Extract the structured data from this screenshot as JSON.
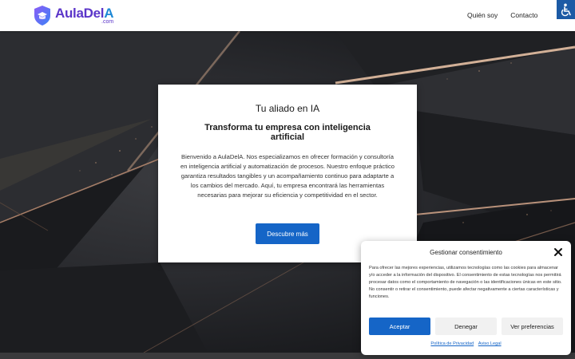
{
  "header": {
    "logo": {
      "main": "AulaDel",
      "accent": "A",
      "sub": ".com"
    },
    "nav": [
      {
        "label": "Quién soy"
      },
      {
        "label": "Contacto"
      }
    ],
    "accessibility_icon": "wheelchair-icon"
  },
  "hero": {
    "card": {
      "title": "Tu aliado en IA",
      "subtitle": "Transforma tu empresa con inteligencia artificial",
      "body": "Bienvenido a AulaDelA. Nos especializamos en ofrecer formación y consultoría en inteligencia artificial y automatización de procesos. Nuestro enfoque práctico garantiza resultados tangibles y un acompañamiento continuo para adaptarte a los cambios del mercado. Aquí, tu empresa encontrará las herramientas necesarias para mejorar su eficiencia y competitividad en el sector.",
      "button": "Descubre más"
    }
  },
  "cookie": {
    "title": "Gestionar consentimiento",
    "text": "Para ofrecer las mejores experiencias, utilizamos tecnologías como las cookies para almacenar y/o acceder a la información del dispositivo. El consentimiento de estas tecnologías nos permitirá procesar datos como el comportamiento de navegación o las identificaciones únicas en este sitio. No consentir o retirar el consentimiento, puede afectar negativamente a ciertas características y funciones.",
    "accept": "Aceptar",
    "deny": "Denegar",
    "preferences": "Ver preferencias",
    "links": {
      "privacy": "Política de Privacidad",
      "legal": "Aviso Legal"
    }
  },
  "colors": {
    "brand_purple": "#5b35c9",
    "brand_blue": "#1e89d6",
    "button_blue": "#1565c7"
  }
}
